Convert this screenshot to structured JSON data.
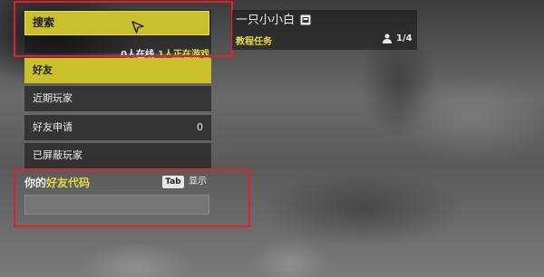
{
  "search": {
    "label": "搜索"
  },
  "status": {
    "online": "0人在线",
    "playing": "1人正在游戏"
  },
  "menu": {
    "items": [
      {
        "label": "好友",
        "count": ""
      },
      {
        "label": "近期玩家",
        "count": ""
      },
      {
        "label": "好友申请",
        "count": "0"
      },
      {
        "label": "已屏蔽玩家",
        "count": ""
      }
    ]
  },
  "friend_code": {
    "label_prefix": "你的",
    "label_highlight": "好友代码",
    "key": "Tab",
    "show_label": "显示",
    "value": ""
  },
  "profile": {
    "name": "一只小小白",
    "tutorial_label": "教程任务",
    "players": "1/4"
  },
  "icons": {
    "cursor": "cursor-arrow-icon",
    "profile": "profile-card-icon",
    "players": "players-icon"
  },
  "colors": {
    "accent_yellow": "#c9c02c",
    "highlight_text": "#e3d942",
    "annotation_red": "#e0202a"
  }
}
